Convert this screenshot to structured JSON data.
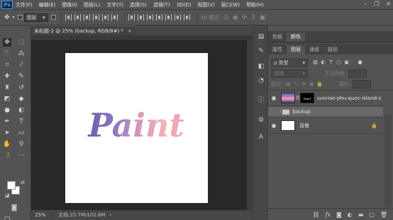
{
  "menubar": {
    "logo": "Ps",
    "items": [
      "文件(F)",
      "编辑(E)",
      "图像(I)",
      "图层(L)",
      "文字(Y)",
      "选择(S)",
      "滤镜(T)",
      "3D(D)",
      "视图(V)",
      "窗口(W)",
      "帮助(H)"
    ],
    "minimize": "–",
    "restore": "❐",
    "close": "✕"
  },
  "optionsbar": {
    "autoselect_target": "图层",
    "mode_3d": "3D 模式:"
  },
  "document": {
    "tab_title": "未标题-2 @ 25% (backup, RGB/8#) *",
    "tab_close": "×",
    "zoom": "25%",
    "doc_size": "文档:25.7M/102.8M",
    "status_arrow": "›",
    "canvas_text": "Paint"
  },
  "swatch_panel": {
    "tabs": [
      "色板",
      "颜色"
    ],
    "active_tab": 1
  },
  "layers_panel": {
    "tabs": [
      "属性",
      "图层",
      "通道",
      "路径"
    ],
    "active_tab": 1,
    "filter_kind": "ρ 类型",
    "blend_mode": "变暗",
    "opacity_label": "不透明度:",
    "lock_label": "锁定:",
    "fill_label": "填充:",
    "layers": [
      {
        "name": "sunrise-phu-quoc-island-oc...",
        "visible": true,
        "thumb": "photo",
        "mask_text": "Paint",
        "selected": false
      },
      {
        "name": "backup",
        "visible": false,
        "thumb": "folder",
        "selected": true
      },
      {
        "name": "背景",
        "visible": true,
        "thumb": "white",
        "locked": true,
        "selected": false
      }
    ]
  },
  "colors": {
    "app_bg": "#535353",
    "workspace_bg": "#282828",
    "canvas_bg": "#ffffff",
    "accent_ps": "#31a8ff",
    "selected_layer": "#686868"
  }
}
